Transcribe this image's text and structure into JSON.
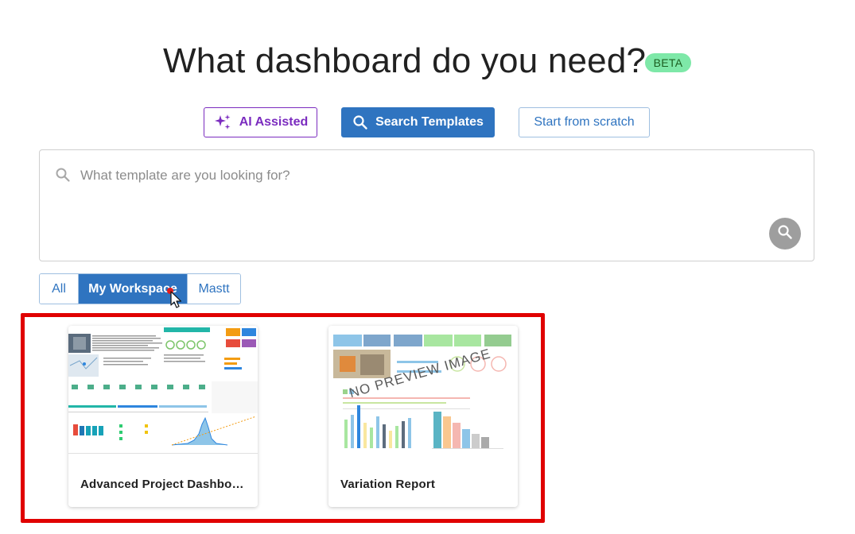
{
  "header": {
    "title": "What dashboard do you need?",
    "badge": "BETA"
  },
  "modes": {
    "ai_label": "AI Assisted",
    "search_label": "Search Templates",
    "scratch_label": "Start from scratch",
    "active": "Search Templates"
  },
  "search": {
    "placeholder": "What template are you looking for?",
    "value": ""
  },
  "filters": {
    "tabs": [
      {
        "label": "All"
      },
      {
        "label": "My Workspace"
      },
      {
        "label": "Mastt"
      }
    ],
    "selected": "My Workspace"
  },
  "templates": [
    {
      "title": "Advanced Project Dashboa…",
      "preview": "dashboard-thumbnail"
    },
    {
      "title": "Variation Report",
      "preview_overlay": "NO PREVIEW IMAGE"
    }
  ],
  "colors": {
    "primary": "#2f74c0",
    "ai_accent": "#7b2cbf",
    "badge_bg": "#7ee8a8",
    "highlight": "#e00000"
  }
}
